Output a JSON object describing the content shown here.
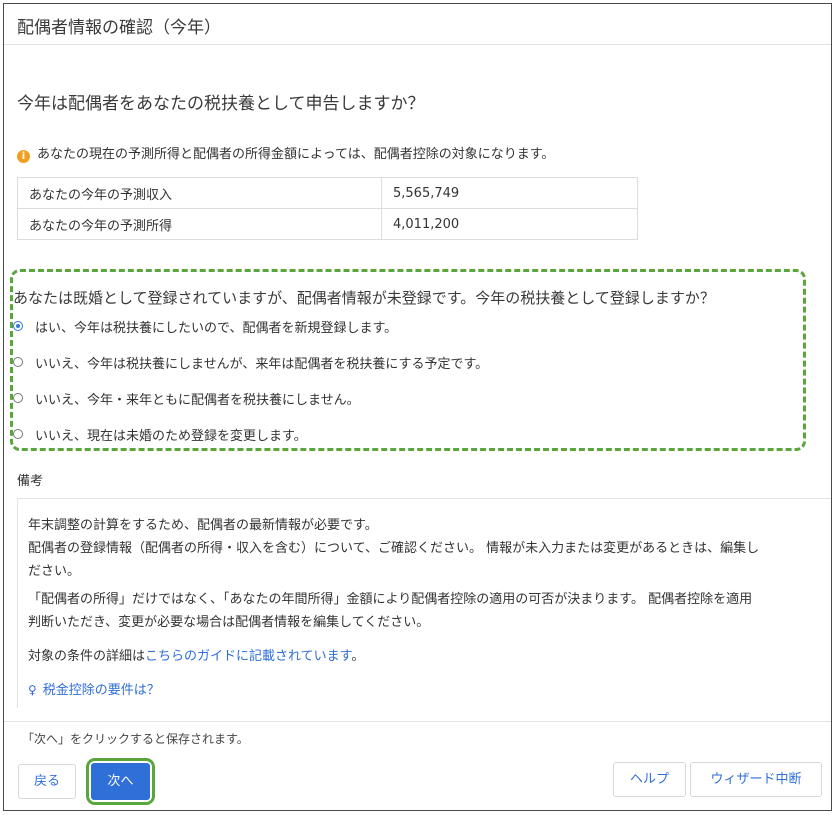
{
  "dialog": {
    "title": "配偶者情報の確認（今年）",
    "question": "今年は配偶者をあなたの税扶養として申告しますか？",
    "info_text": "あなたの現在の予測所得と配偶者の所得金額によっては、配偶者控除の対象になります。",
    "info_icon": "info-icon"
  },
  "income_table": {
    "rows": [
      {
        "label": "あなたの今年の予測収入",
        "value": "5,565,749"
      },
      {
        "label": "あなたの今年の予測所得",
        "value": "4,011,200"
      }
    ]
  },
  "spouse": {
    "question": "あなたは既婚として登録されていますが、配偶者情報が未登録です。今年の税扶養として登録しますか？",
    "options": [
      {
        "label": "はい、今年は税扶養にしたいので、配偶者を新規登録します。",
        "selected": true
      },
      {
        "label": "いいえ、今年は税扶養にしませんが、来年は配偶者を税扶養にする予定です。",
        "selected": false
      },
      {
        "label": "いいえ、今年・来年ともに配偶者を税扶養にしません。",
        "selected": false
      },
      {
        "label": "いいえ、現在は未婚のため登録を変更します。",
        "selected": false
      }
    ]
  },
  "notes": {
    "label": "備考",
    "line1": "年末調整の計算をするため、配偶者の最新情報が必要です。",
    "line2": "配偶者の登録情報（配偶者の所得・収入を含む）について、ご確認ください。 情報が未入力または変更があるときは、編集し",
    "line3": "ださい。",
    "line4": "「配偶者の所得」だけではなく、「あなたの年間所得」金額により配偶者控除の適用の可否が決まります。 配偶者控除を適用",
    "line5": "判断いただき、変更が必要な場合は配偶者情報を編集してください。",
    "guide_prefix": "対象の条件の詳細は",
    "guide_link": "こちらのガイドに記載されています",
    "guide_suffix": "。",
    "tip_link": "税金控除の要件は？",
    "tip_icon": "lightbulb-icon"
  },
  "footer": {
    "save_note": "「次へ」をクリックすると保存されます。",
    "back_label": "戻る",
    "next_label": "次へ",
    "help_label": "ヘルプ",
    "abort_label": "ウィザード中断"
  },
  "colors": {
    "primary": "#2f6fd8",
    "highlight_border": "#5aa63c",
    "info_icon": "#f0a020"
  }
}
